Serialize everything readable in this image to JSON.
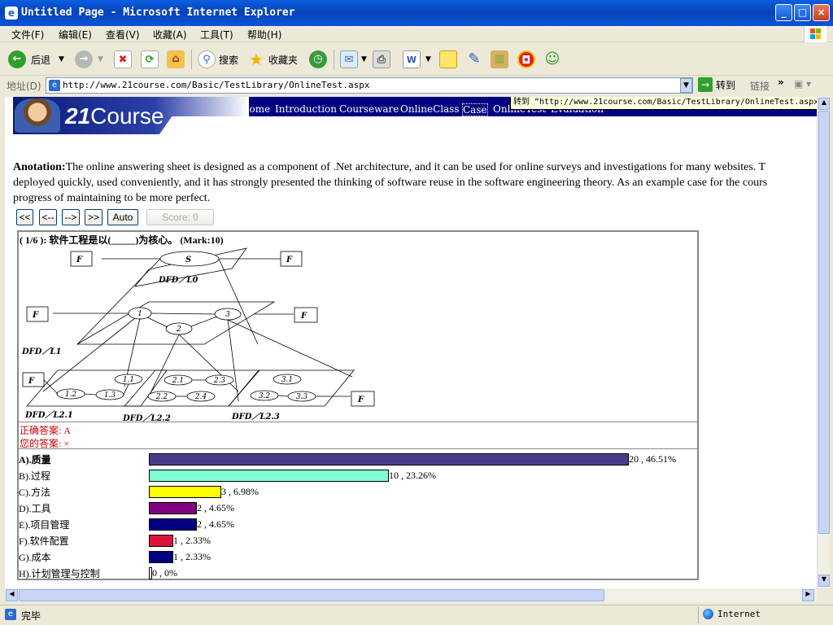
{
  "window": {
    "title": "Untitled Page - Microsoft Internet Explorer"
  },
  "menu": [
    "文件(F)",
    "编辑(E)",
    "查看(V)",
    "收藏(A)",
    "工具(T)",
    "帮助(H)"
  ],
  "toolbar": {
    "back": "后退",
    "search": "搜索",
    "favorites": "收藏夹"
  },
  "address": {
    "label": "地址(D)",
    "url": "http://www.21course.com/Basic/TestLibrary/OnlineTest.aspx",
    "go": "转到",
    "links": "链接"
  },
  "tooltip": "转到 “http://www.21course.com/Basic/TestLibrary/OnlineTest.aspx”",
  "site": {
    "logo_num": "21",
    "logo_text": "Course",
    "nav": [
      "Home",
      "Introduction",
      "Courseware",
      "OnlineClass",
      "Case",
      "OnlineTest",
      "Evaluation"
    ]
  },
  "annotation": {
    "label": "Anotation:",
    "line1": "The online answering sheet is designed as a component of .Net architecture, and it can be used for online surveys and investigations for many websites. T",
    "line2": "deployed quickly, used conveniently, and it has strongly presented the thinking of software reuse in the software engineering theory. As an example case for the cours",
    "line3": "progress of maintaining to be more perfect."
  },
  "controls": {
    "first": "<<",
    "prev": "<--",
    "next": "-->",
    "last": ">>",
    "auto": "Auto",
    "score": "Score:  0"
  },
  "question": {
    "header": "( 1/6 ): 软件工程是以(_____)为核心。  (Mark:10)",
    "correct": "正确答案: A",
    "yours": "您的答案: ×"
  },
  "diagram": {
    "l0": "DFD／L0",
    "l1": "DFD／L1",
    "l21": "DFD／L2.1",
    "l22": "DFD／L2.2",
    "l23": "DFD／L2.3",
    "f": "F",
    "s": "S",
    "n1": "1",
    "n2": "2",
    "n3": "3",
    "n11": "1.1",
    "n12": "1.2",
    "n13": "1.3",
    "n21": "2.1",
    "n22": "2.2",
    "n23": "2.3",
    "n24": "2.4",
    "n31": "3.1",
    "n32": "3.2",
    "n33": "3.3"
  },
  "options": [
    {
      "label": "A).质量",
      "value": 20,
      "percent": "46.51%",
      "display": "20 , 46.51%",
      "color": "#483d8b",
      "bold": true
    },
    {
      "label": "B).过程",
      "value": 10,
      "percent": "23.26%",
      "display": "10 , 23.26%",
      "color": "#7fffd4"
    },
    {
      "label": "C).方法",
      "value": 3,
      "percent": "6.98%",
      "display": "3 , 6.98%",
      "color": "#ffff00"
    },
    {
      "label": "D).工具",
      "value": 2,
      "percent": "4.65%",
      "display": "2 , 4.65%",
      "color": "#800080"
    },
    {
      "label": "E).项目管理",
      "value": 2,
      "percent": "4.65%",
      "display": "2 , 4.65%",
      "color": "#000080"
    },
    {
      "label": "F).软件配置",
      "value": 1,
      "percent": "2.33%",
      "display": "1 , 2.33%",
      "color": "#dc143c"
    },
    {
      "label": "G).成本",
      "value": 1,
      "percent": "2.33%",
      "display": "1 , 2.33%",
      "color": "#000080"
    },
    {
      "label": "H).计划管理与控制",
      "value": 0,
      "percent": "0%",
      "display": "0 , 0%",
      "color": "#ffffff"
    }
  ],
  "status": {
    "text": "完毕",
    "zone": "Internet"
  }
}
